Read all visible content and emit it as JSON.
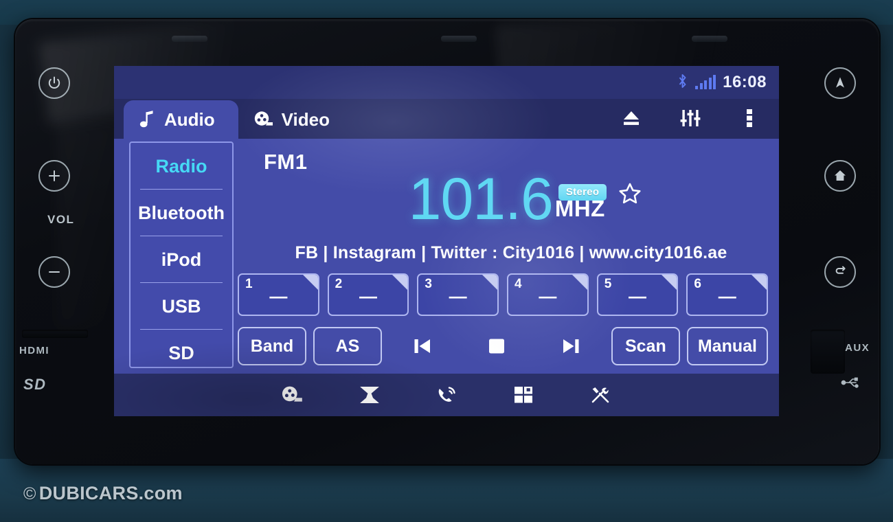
{
  "device": {
    "name": "car-infotainment-head-unit",
    "watermark_symbol": "©",
    "watermark_text": "DUBICARS.com"
  },
  "bezel": {
    "left": {
      "power_label": "power-button",
      "volume_up_label": "+",
      "volume_label": "VOL",
      "volume_down_label": "−",
      "hdmi_label": "HDMI",
      "sd_label": "SD"
    },
    "right": {
      "nav_label": "navigation-button",
      "home_label": "home-button",
      "back_label": "back-button",
      "aux_label": "AUX"
    }
  },
  "status_bar": {
    "bluetooth_icon": "bluetooth-icon",
    "signal_icon": "signal-bars-icon",
    "signal_bars": 5,
    "time": "16:08"
  },
  "tabs": [
    {
      "label": "Audio",
      "icon": "music-note-icon",
      "active": true
    },
    {
      "label": "Video",
      "icon": "film-reel-icon",
      "active": false
    }
  ],
  "toolbar": [
    {
      "name": "eject-button",
      "icon": "eject-icon"
    },
    {
      "name": "equalizer-button",
      "icon": "equalizer-sliders-icon"
    },
    {
      "name": "more-options-button",
      "icon": "more-vertical-icon"
    }
  ],
  "sources": [
    {
      "label": "Radio",
      "selected": true
    },
    {
      "label": "Bluetooth",
      "selected": false
    },
    {
      "label": "iPod",
      "selected": false
    },
    {
      "label": "USB",
      "selected": false
    },
    {
      "label": "SD",
      "selected": false
    }
  ],
  "tuner": {
    "band": "FM1",
    "frequency": "101.6",
    "unit": "MHZ",
    "stereo_badge": "Stereo",
    "favorite_icon": "star-outline-icon",
    "rds_text": "FB | Instagram | Twitter : City1016 | www.city1016.ae"
  },
  "presets": [
    {
      "number": "1",
      "value": "—"
    },
    {
      "number": "2",
      "value": "—"
    },
    {
      "number": "3",
      "value": "—"
    },
    {
      "number": "4",
      "value": "—"
    },
    {
      "number": "5",
      "value": "—"
    },
    {
      "number": "6",
      "value": "—"
    }
  ],
  "controls": [
    {
      "name": "band-button",
      "label": "Band",
      "type": "text"
    },
    {
      "name": "auto-store-button",
      "label": "AS",
      "type": "text"
    },
    {
      "name": "previous-button",
      "label": "",
      "type": "icon",
      "icon": "skip-previous-icon"
    },
    {
      "name": "stop-button",
      "label": "",
      "type": "icon",
      "icon": "stop-square-icon"
    },
    {
      "name": "next-button",
      "label": "",
      "type": "icon",
      "icon": "skip-next-icon"
    },
    {
      "name": "scan-button",
      "label": "Scan",
      "type": "text"
    },
    {
      "name": "manual-button",
      "label": "Manual",
      "type": "text"
    }
  ],
  "dock": [
    {
      "name": "media-button",
      "icon": "film-reel-icon"
    },
    {
      "name": "navigation-button",
      "icon": "map-icon"
    },
    {
      "name": "phone-button",
      "icon": "phone-call-icon"
    },
    {
      "name": "apps-button",
      "icon": "apps-grid-icon"
    },
    {
      "name": "settings-button",
      "icon": "tools-icon"
    }
  ],
  "colors": {
    "screen_bg": "#3c45a8",
    "accent_cyan": "#5fd8f3",
    "status_bar_bg": "#2c3273",
    "tab_active_bg": "#444ca8",
    "badge_bg": "#7fe4f5",
    "text_white": "#ffffff",
    "bezel_black": "#0b0d12"
  }
}
